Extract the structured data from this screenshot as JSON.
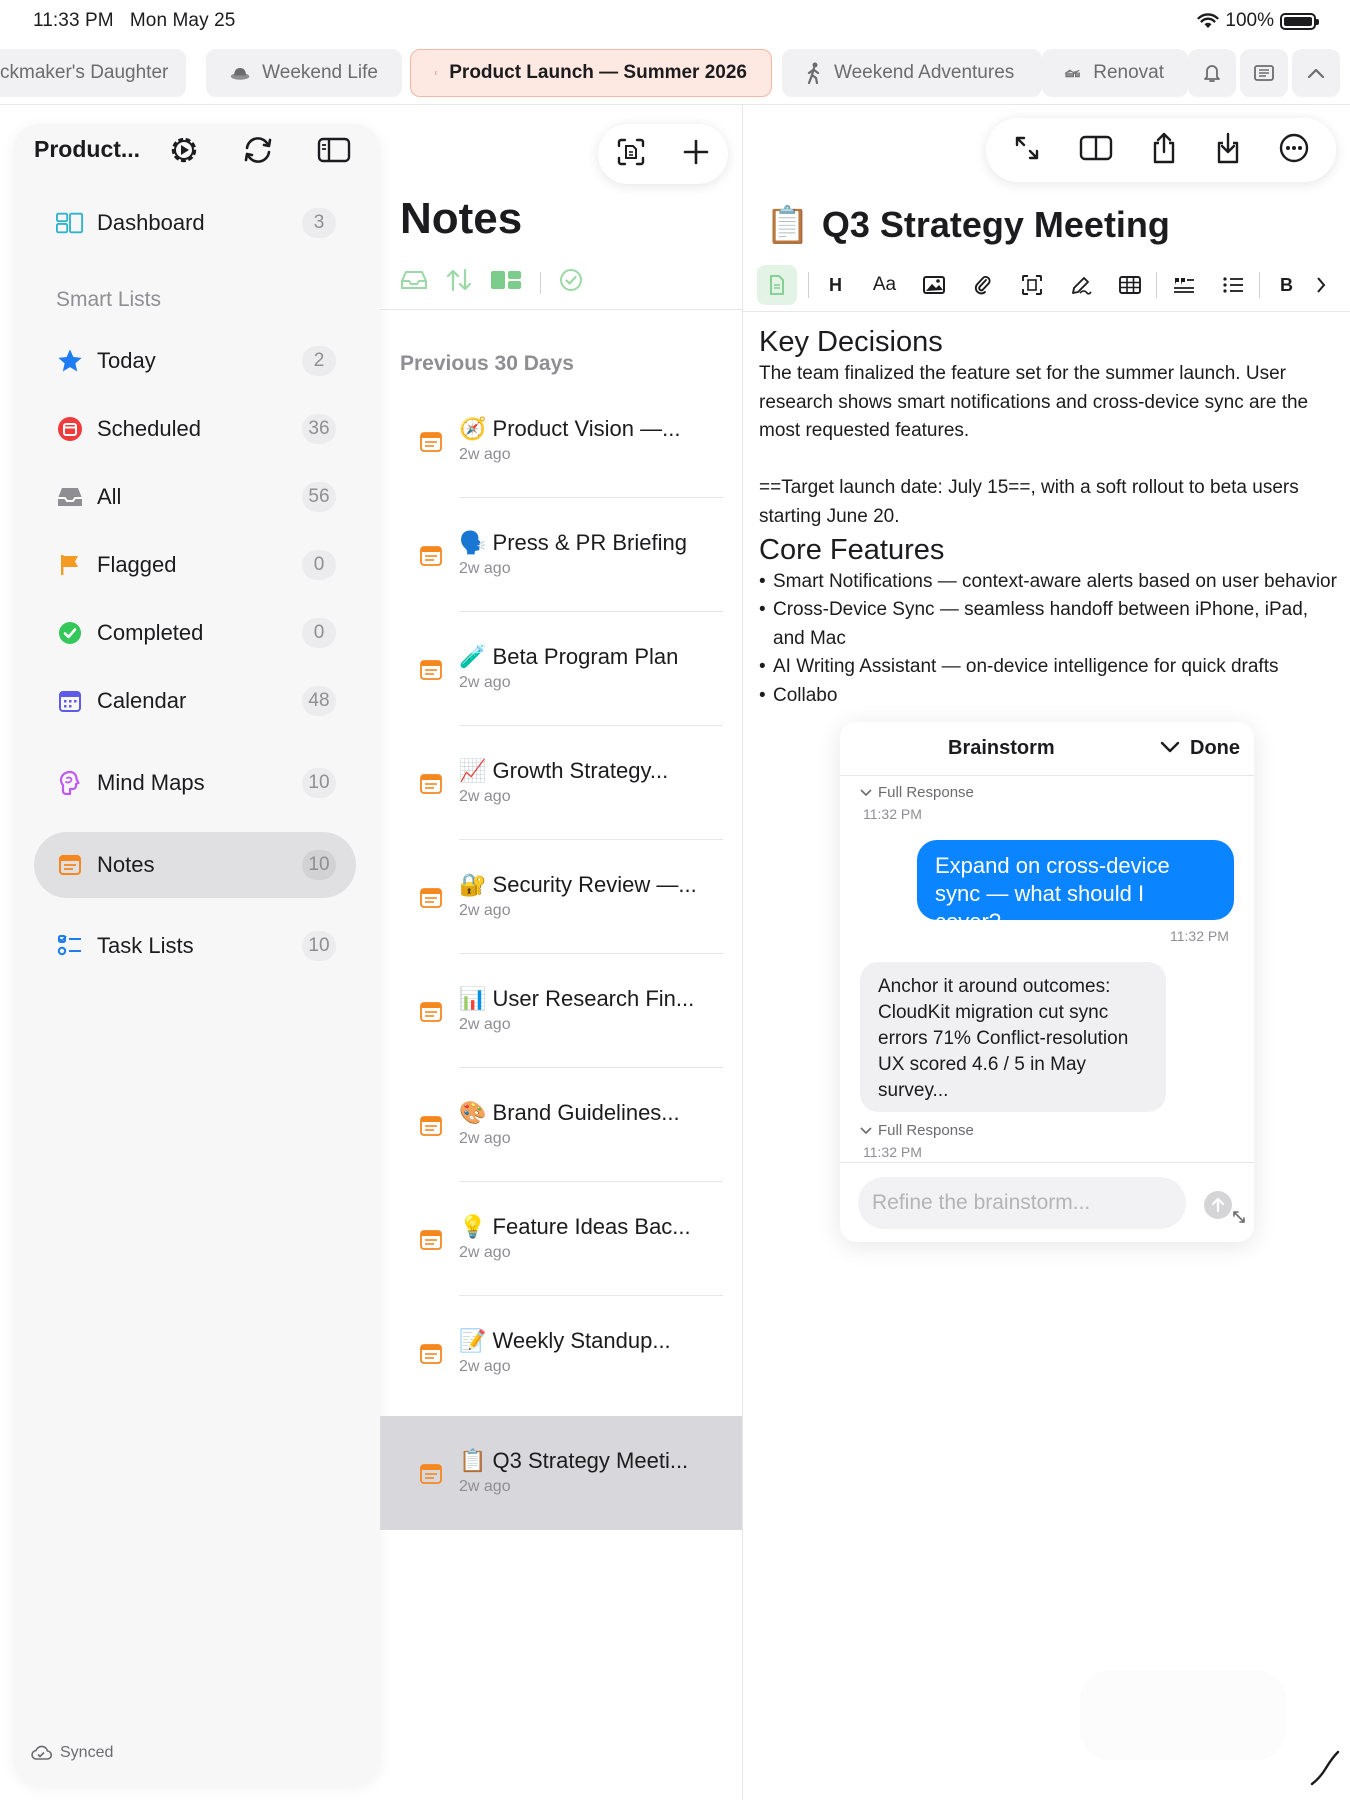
{
  "status": {
    "time": "11:33 PM",
    "date": "Mon May 25",
    "battery": "100%"
  },
  "tabs": [
    {
      "label": "ckmaker's Daughter",
      "icon": "book-icon",
      "active": false
    },
    {
      "label": "Weekend Life",
      "icon": "hat-icon",
      "active": false
    },
    {
      "label": "Product Launch — Summer 2026",
      "icon": "notebook-icon",
      "active": true
    },
    {
      "label": "Weekend Adventures",
      "icon": "hiker-icon",
      "active": false
    },
    {
      "label": "Renovat",
      "icon": "house-icon",
      "active": false
    }
  ],
  "tab_buttons": [
    "bell-icon",
    "reader-icon",
    "chevron-up-icon"
  ],
  "sidebar": {
    "title": "Product...",
    "items": [
      {
        "label": "Dashboard",
        "count": "3",
        "icon": "dashboard-icon"
      },
      {
        "label": "Today",
        "count": "2",
        "icon": "star-icon"
      },
      {
        "label": "Scheduled",
        "count": "36",
        "icon": "scheduled-icon"
      },
      {
        "label": "All",
        "count": "56",
        "icon": "tray-icon"
      },
      {
        "label": "Flagged",
        "count": "0",
        "icon": "flag-icon"
      },
      {
        "label": "Completed",
        "count": "0",
        "icon": "checkmark-icon"
      },
      {
        "label": "Calendar",
        "count": "48",
        "icon": "calendar-icon"
      },
      {
        "label": "Mind Maps",
        "count": "10",
        "icon": "brain-icon"
      },
      {
        "label": "Notes",
        "count": "10",
        "icon": "note-icon",
        "selected": true
      },
      {
        "label": "Task Lists",
        "count": "10",
        "icon": "checklist-icon"
      }
    ],
    "section_smart": "Smart Lists",
    "sync_status": "Synced"
  },
  "notes_list": {
    "title": "Notes",
    "section": "Previous 30 Days",
    "items": [
      {
        "emoji": "🧭",
        "title": "Product Vision —...",
        "time": "2w ago"
      },
      {
        "emoji": "🗣️",
        "title": "Press & PR Briefing",
        "time": "2w ago"
      },
      {
        "emoji": "🧪",
        "title": "Beta Program Plan",
        "time": "2w ago"
      },
      {
        "emoji": "📈",
        "title": "Growth Strategy...",
        "time": "2w ago"
      },
      {
        "emoji": "🔐",
        "title": "Security Review —...",
        "time": "2w ago"
      },
      {
        "emoji": "📊",
        "title": "User Research Fin...",
        "time": "2w ago"
      },
      {
        "emoji": "🎨",
        "title": "Brand Guidelines...",
        "time": "2w ago"
      },
      {
        "emoji": "💡",
        "title": "Feature Ideas Bac...",
        "time": "2w ago"
      },
      {
        "emoji": "📝",
        "title": "Weekly Standup...",
        "time": "2w ago"
      },
      {
        "emoji": "📋",
        "title": "Q3 Strategy Meeti...",
        "time": "2w ago",
        "selected": true
      }
    ]
  },
  "editor": {
    "emoji": "📋",
    "title": "Q3 Strategy Meeting",
    "format_buttons": {
      "heading": "H",
      "text_style": "Aa",
      "bold": "B"
    },
    "h_key_decisions": "Key Decisions",
    "p1": "The team finalized the feature set for the summer launch. User research shows smart notifications and cross-device sync are the most requested features.",
    "p2": "==Target launch date: July 15==, with a soft rollout to beta users starting June 20.",
    "h_core_features": "Core Features",
    "bullets": [
      "Smart Notifications — context-aware alerts based on user behavior",
      "Cross-Device Sync — seamless handoff between iPhone, iPad, and Mac",
      "AI Writing Assistant — on-device intelligence for quick drafts",
      "Collabo"
    ]
  },
  "brainstorm": {
    "title": "Brainstorm",
    "done": "Done",
    "full_response_1": "Full Response",
    "time_1": "11:32 PM",
    "user_message": "Expand on cross-device sync — what should I cover?",
    "user_time": "11:32 PM",
    "ai_message": "Anchor it around outcomes: CloudKit migration cut sync errors 71% Conflict-resolution UX scored 4.6 / 5 in May survey...",
    "full_response_2": "Full Response",
    "time_2": "11:32 PM",
    "input_placeholder": "Refine the brainstorm..."
  }
}
